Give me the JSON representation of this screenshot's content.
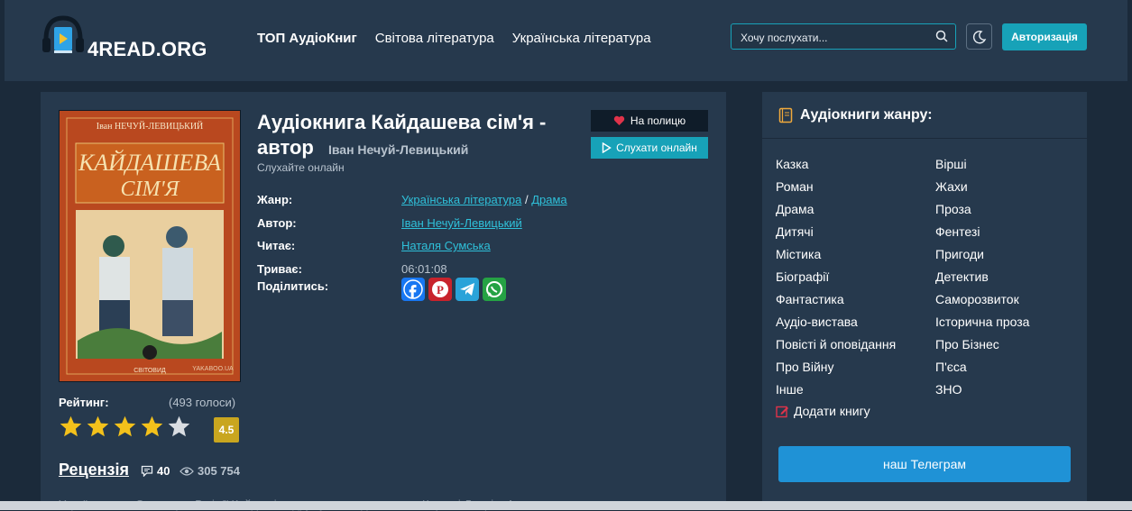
{
  "header": {
    "logo_text": "4READ.ORG",
    "nav": [
      "ТОП АудіоКниг",
      "Світова література",
      "Українська література"
    ],
    "search_placeholder": "Хочу послухати...",
    "auth_label": "Авторизація",
    "colors": {
      "accent": "#17a2b8",
      "bg": "#26394d"
    }
  },
  "book": {
    "title_line": "Аудіокнига Кайдашева сім'я - автор",
    "author_inline": "Іван Нечуй-Левицький",
    "subtitle": "Слухайте онлайн",
    "shelf_label": "На полицю",
    "listen_label": "Слухати онлайн",
    "cover": {
      "author": "Іван НЕЧУЙ-ЛЕВИЦЬКИЙ",
      "title_top": "КАЙДАШЕВА",
      "title_bottom": "СІМ'Я",
      "publisher": "СВІТОВИД",
      "watermark": "YAKABOO.UA"
    },
    "meta": {
      "genre_label": "Жанр:",
      "genre_1": "Українська література",
      "genre_sep": "/",
      "genre_2": "Драма",
      "author_label": "Автор:",
      "author": "Іван Нечуй-Левицький",
      "reader_label": "Читає:",
      "reader": "Наталя Сумська",
      "duration_label": "Триває:",
      "duration": "06:01:08",
      "share_label": "Поділитись:"
    },
    "share_icons": [
      "facebook-icon",
      "pinterest-icon",
      "telegram-icon",
      "whatsapp-icon"
    ],
    "rating": {
      "label": "Рейтинг:",
      "votes": "(493 голоси)",
      "stars": 4,
      "max_stars": 5,
      "score": "4.5"
    },
    "review_label": "Рецензія",
    "comments": "40",
    "views": "305 754",
    "description_preview": "Україна, село Семигори. В сім'ї Кайдашів одружуються два сини – Карпо і Лаврін. Але немає спокою"
  },
  "sidebar": {
    "title": "Аудіокниги жанру:",
    "genres_left": [
      "Казка",
      "Роман",
      "Драма",
      "Дитячі",
      "Містика",
      "Біографії",
      "Фантастика",
      "Аудіо-вистава",
      "Повісті й оповідання",
      "Про Війну",
      "Інше"
    ],
    "genres_right": [
      "Вірші",
      "Жахи",
      "Проза",
      "Фентезі",
      "Пригоди",
      "Детектив",
      "Саморозвиток",
      "Історична проза",
      "Про Бізнес",
      "П'єса",
      "ЗНО"
    ],
    "add_book": "Додати книгу",
    "telegram_label": "наш Телеграм"
  }
}
